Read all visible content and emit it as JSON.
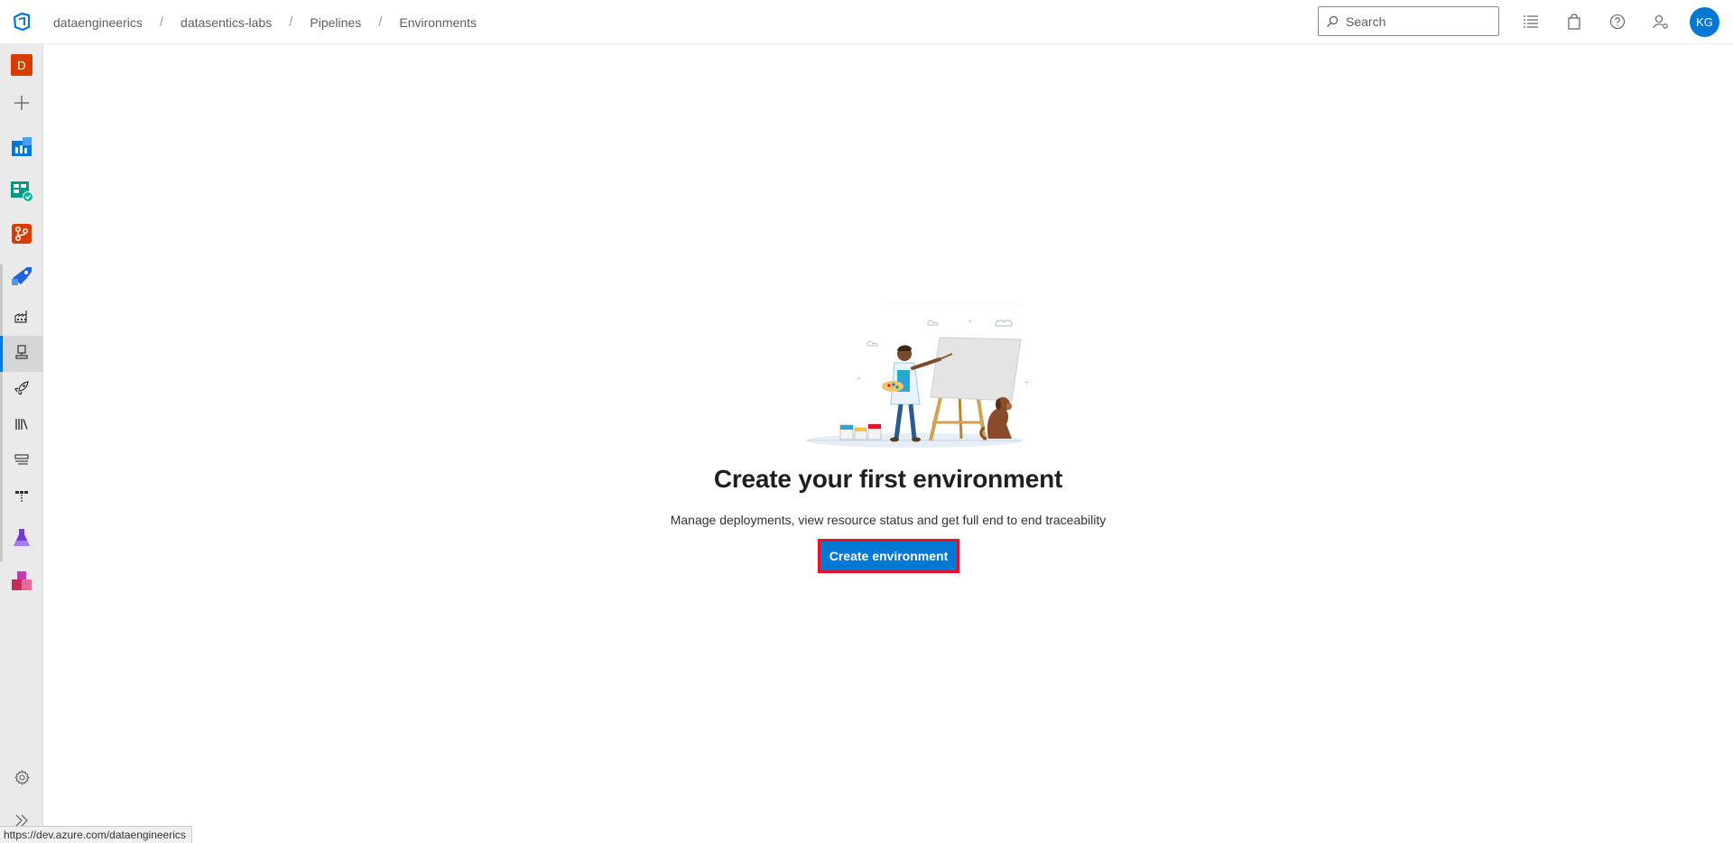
{
  "header": {
    "breadcrumb": [
      {
        "label": "dataengineerics"
      },
      {
        "label": "datasentics-labs"
      },
      {
        "label": "Pipelines"
      },
      {
        "label": "Environments"
      }
    ],
    "search": {
      "placeholder": "Search",
      "value": ""
    },
    "user_initials": "KG"
  },
  "sidebar": {
    "org_initial": "D",
    "items": [
      {
        "name": "new",
        "icon": "plus-icon"
      },
      {
        "name": "overview",
        "icon": "overview-icon"
      },
      {
        "name": "boards",
        "icon": "boards-icon"
      },
      {
        "name": "repos",
        "icon": "repos-icon"
      },
      {
        "name": "pipelines",
        "icon": "pipelines-icon"
      },
      {
        "name": "pipelines-builds",
        "icon": "factory-icon"
      },
      {
        "name": "environments",
        "icon": "environments-icon",
        "active": true
      },
      {
        "name": "releases",
        "icon": "rocket-icon"
      },
      {
        "name": "library",
        "icon": "library-icon"
      },
      {
        "name": "task-groups",
        "icon": "task-groups-icon"
      },
      {
        "name": "deployment-groups",
        "icon": "deployment-groups-icon"
      },
      {
        "name": "test-plans",
        "icon": "flask-icon"
      },
      {
        "name": "artifacts",
        "icon": "artifacts-icon"
      }
    ],
    "settings_icon": "gear-icon",
    "collapse_icon": "double-chevron-right-icon"
  },
  "empty_state": {
    "title": "Create your first environment",
    "description": "Manage deployments, view resource status and get full end to end traceability",
    "button_label": "Create environment"
  },
  "status_bar": {
    "url": "https://dev.azure.com/dataengineerics"
  },
  "colors": {
    "accent": "#0078d4",
    "highlight_border": "#e81123",
    "org_badge": "#da3b01"
  }
}
